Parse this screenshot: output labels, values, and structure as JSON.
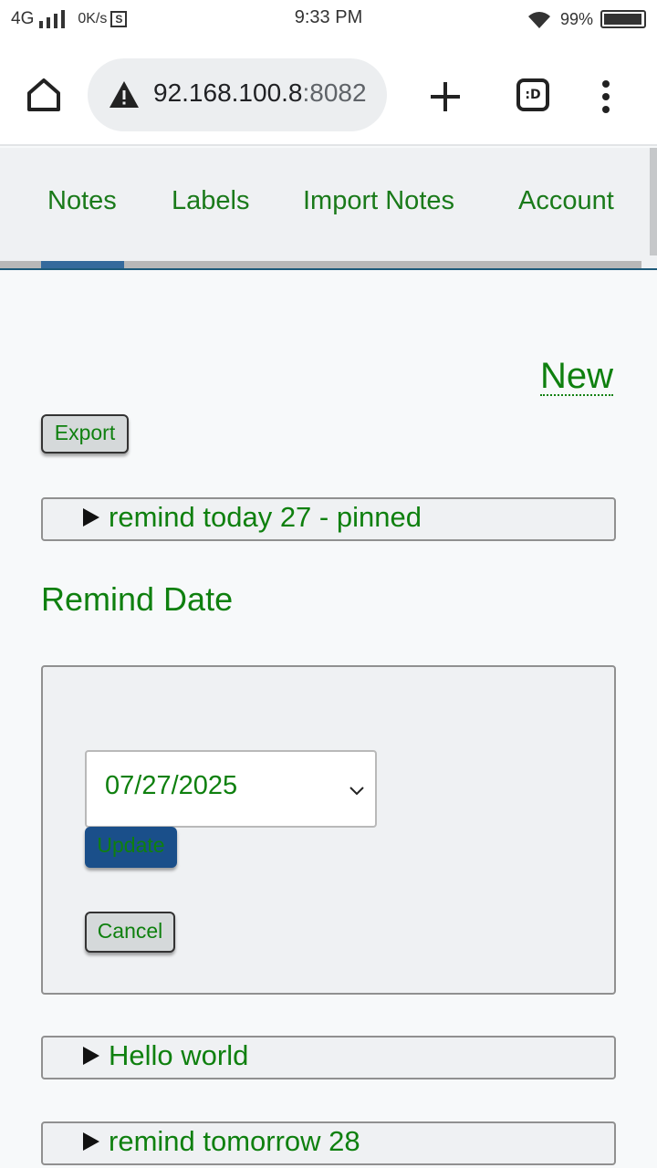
{
  "status_bar": {
    "network": "4G",
    "speed": "0K/s",
    "sim_icon": "S",
    "time": "9:33 PM",
    "battery": "99%"
  },
  "browser": {
    "url_host": "92.168.100.8",
    "url_port": ":8082",
    "tabs_icon_label": ":D"
  },
  "nav": {
    "items": [
      {
        "label": "Notes"
      },
      {
        "label": "Labels"
      },
      {
        "label": "Import Notes"
      },
      {
        "label": "Account"
      }
    ]
  },
  "toolbar": {
    "new_label": "New",
    "export_label": "Export"
  },
  "notes": [
    {
      "summary": "remind today 27 - pinned"
    },
    {
      "summary": "Hello world"
    },
    {
      "summary": "remind tomorrow 28"
    }
  ],
  "remind_form": {
    "heading": "Remind Date",
    "selected_date": "07/27/2025",
    "update_label": "Update",
    "cancel_label": "Cancel"
  },
  "colors": {
    "link_green": "#0f800f",
    "primary_blue": "#1a4f8a",
    "nav_bg": "#eff1f3"
  }
}
